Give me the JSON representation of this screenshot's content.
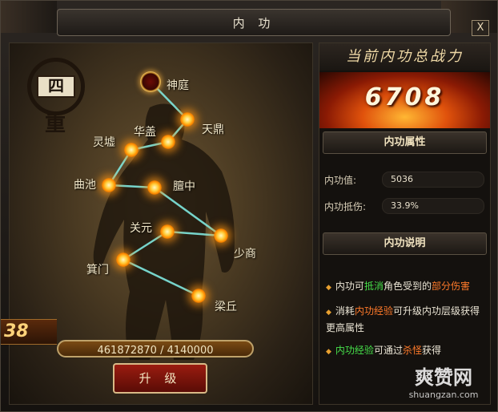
{
  "window": {
    "title": "内 功",
    "close_label": "X"
  },
  "tier": {
    "number": "四",
    "unit": "重"
  },
  "nodes": [
    {
      "name": "神庭",
      "active": true
    },
    {
      "name": "天鼎"
    },
    {
      "name": "华盖"
    },
    {
      "name": "灵墟"
    },
    {
      "name": "曲池"
    },
    {
      "name": "膻中"
    },
    {
      "name": "关元"
    },
    {
      "name": "少商"
    },
    {
      "name": "箕门"
    },
    {
      "name": "梁丘"
    }
  ],
  "level_badge": "38",
  "experience": {
    "current": "461872870",
    "required": "4140000",
    "text": "461872870 / 4140000"
  },
  "upgrade_button": "升 级",
  "power": {
    "title": "当前内功总战力",
    "value": "6708"
  },
  "attributes": {
    "heading": "内功属性",
    "rows": [
      {
        "label": "内功值:",
        "value": "5036"
      },
      {
        "label": "内功抵伤:",
        "value": "33.9%"
      }
    ]
  },
  "description": {
    "heading": "内功说明",
    "lines": [
      {
        "pre": "内功可",
        "hl": "抵消",
        "mid": "角色受到的",
        "hl2": "部分伤害",
        "post": ""
      },
      {
        "pre": "消耗",
        "hl": "内功经验",
        "mid": "可升级内功层级获得更高属性",
        "hl2": "",
        "post": ""
      },
      {
        "pre": "",
        "hl": "内功经验",
        "mid": "可通过",
        "hl2": "杀怪",
        "post": "获得"
      }
    ]
  },
  "watermark": {
    "main": "爽赞网",
    "sub": "shuangzan.com"
  }
}
